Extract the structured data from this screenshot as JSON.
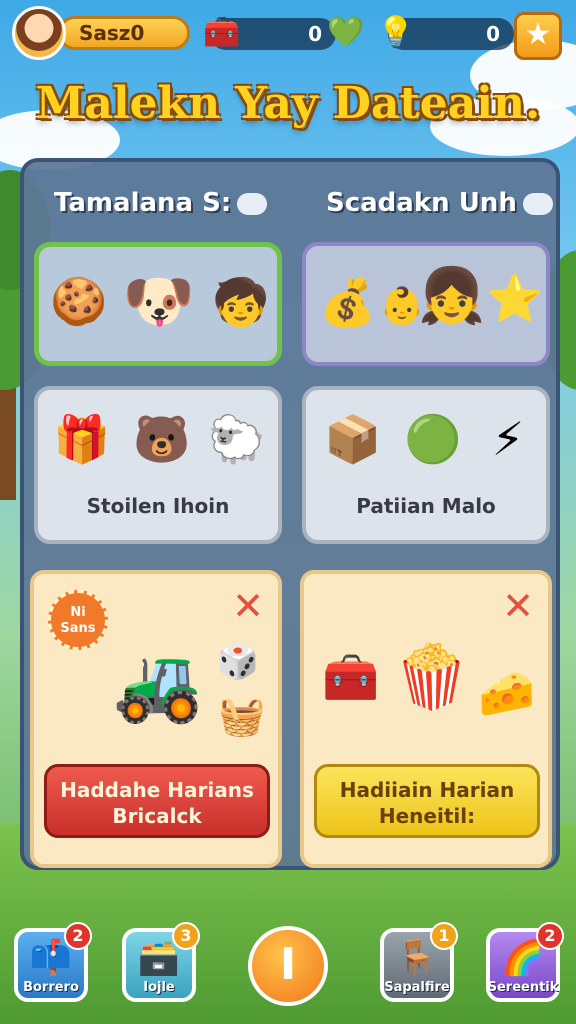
{
  "topbar": {
    "coins": "Sasz0",
    "resource1_value": "0",
    "resource2_value": "0",
    "icons": {
      "avatar": "player-avatar",
      "chest": "chest-icon",
      "gem": "gem-icon",
      "bulb": "lightbulb-icon",
      "star": "star-icon"
    }
  },
  "title": "Malekn Yay Dateain.",
  "columns": {
    "left_heading": "Tamalana S:",
    "right_heading": "Scadakn Unh"
  },
  "cards": {
    "card3_label": "Stoilen Ihoin",
    "card4_label": "Patiian Malo"
  },
  "offers": {
    "left": {
      "badge": "Ni Sans",
      "button_line1": "Haddahe Harians",
      "button_line2": "Bricalck"
    },
    "right": {
      "button_line1": "Hadiiain Harian",
      "button_line2": "Heneitil:"
    }
  },
  "nav": {
    "items": [
      {
        "label": "Borrero",
        "count": "2",
        "badge_color": "#e0332a"
      },
      {
        "label": "Iojle",
        "count": "3",
        "badge_color": "#f0a21c"
      },
      {
        "label": "Sapalfire",
        "count": "1",
        "badge_color": "#f0a21c"
      },
      {
        "label": "Sereentik",
        "count": "2",
        "badge_color": "#e0332a"
      }
    ],
    "center_symbol": "I"
  },
  "colors": {
    "title": "#ffd21f",
    "panel": "#5c7696",
    "selected_border": "#6fc24a",
    "red_button": "#d63a32",
    "yellow_button": "#f2cf2a"
  }
}
